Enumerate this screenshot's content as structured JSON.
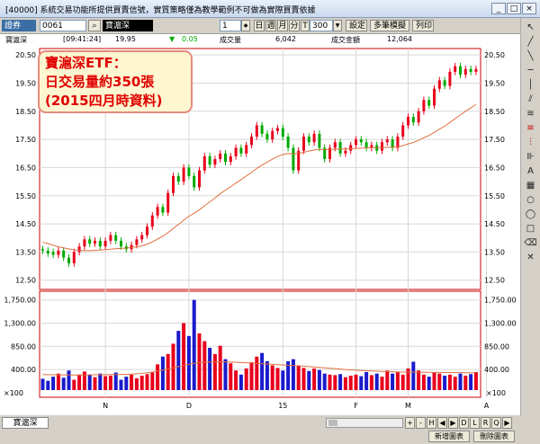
{
  "window": {
    "title": "[40000] 系統交易功能所提供買賣信號，實質策略僅為教學範例不可做為實際買賣依據",
    "minimize_glyph": "_",
    "restore_glyph": "□",
    "close_glyph": "×"
  },
  "toolbar": {
    "market_select": "證券",
    "symbol_code": "0061",
    "symbol_name": "寶滬深",
    "field_value": "1",
    "period_buttons": [
      "日",
      "週",
      "月",
      "分",
      "T"
    ],
    "count_value": "300",
    "settings_label": "設定",
    "params_label": "多筆模擬",
    "print_label": "列印"
  },
  "infobar": {
    "name": "寶滬深",
    "time": "[09:41:24]",
    "price": "19.95",
    "change_arrow": "▼",
    "change": "0.05",
    "volume_label": "成交量",
    "volume_value": "6,042",
    "amount_label": "成交金額",
    "amount_value": "12,064"
  },
  "annotation": {
    "line1": "寶滬深ETF：",
    "line2": "日交易量約350張",
    "line3": "(2015四月時資料)"
  },
  "bottom": {
    "tab_label": "寶滬深",
    "add_chart_label": "新增圖表",
    "remove_chart_label": "刪除圖表",
    "nav_buttons": [
      "+",
      "-",
      "H",
      "◀",
      "▶",
      "D",
      "L",
      "R",
      "Q",
      "▶"
    ]
  },
  "sidebar": {
    "tools": [
      "cursor-tool",
      "line-tool",
      "diagonal-tool",
      "horizontal-tool",
      "vertical-tool",
      "parallel-tool",
      "fan-tool",
      "fibonacci-tool",
      "text-tool",
      "grid-tool",
      "circle-tool",
      "ellipse-tool",
      "rectangle-tool",
      "eraser-tool",
      "delete-tool"
    ]
  },
  "colors": {
    "up": "#e8001c",
    "down": "#00aa00",
    "volume_down": "#1a1acc",
    "ma": "#e07040",
    "grid": "#d8d8d8",
    "panel_border": "#cc0000"
  },
  "chart_data": {
    "type": "candlestick",
    "price_axis": {
      "ticks": [
        "20.50",
        "19.50",
        "18.50",
        "17.50",
        "16.50",
        "15.50",
        "14.50",
        "13.50",
        "12.50"
      ],
      "ylim": [
        12.3,
        20.6
      ]
    },
    "volume_axis": {
      "ticks": [
        "1,750.00",
        "1,300.00",
        "850.00",
        "400.00"
      ],
      "ylim": [
        0,
        1850
      ]
    },
    "volume_unit_label": "×100",
    "x_ticks": [
      {
        "label": "N",
        "i": 12
      },
      {
        "label": "D",
        "i": 28
      },
      {
        "label": "15",
        "i": 46
      },
      {
        "label": "F",
        "i": 60
      },
      {
        "label": "M",
        "i": 70
      },
      {
        "label": "A",
        "i": 85
      }
    ],
    "candles": [
      [
        13.6,
        13.55
      ],
      [
        13.55,
        13.45
      ],
      [
        13.5,
        13.4
      ],
      [
        13.4,
        13.55
      ],
      [
        13.55,
        13.3
      ],
      [
        13.3,
        13.1
      ],
      [
        13.1,
        13.5
      ],
      [
        13.5,
        13.7
      ],
      [
        13.7,
        13.95
      ],
      [
        13.95,
        13.8
      ],
      [
        13.8,
        13.9
      ],
      [
        13.9,
        13.7
      ],
      [
        13.7,
        13.9
      ],
      [
        13.9,
        14.1
      ],
      [
        14.1,
        13.9
      ],
      [
        13.9,
        13.7
      ],
      [
        13.7,
        13.6
      ],
      [
        13.6,
        13.75
      ],
      [
        13.75,
        13.95
      ],
      [
        13.95,
        14.1
      ],
      [
        14.1,
        14.4
      ],
      [
        14.4,
        14.8
      ],
      [
        14.8,
        15.1
      ],
      [
        15.1,
        14.9
      ],
      [
        14.9,
        15.6
      ],
      [
        15.6,
        16.2
      ],
      [
        16.2,
        16.0
      ],
      [
        16.0,
        16.5
      ],
      [
        16.5,
        16.2
      ],
      [
        16.2,
        15.8
      ],
      [
        15.8,
        16.4
      ],
      [
        16.4,
        16.9
      ],
      [
        16.9,
        16.6
      ],
      [
        16.6,
        16.8
      ],
      [
        16.8,
        17.0
      ],
      [
        17.0,
        16.7
      ],
      [
        16.7,
        16.9
      ],
      [
        16.9,
        17.2
      ],
      [
        17.2,
        17.0
      ],
      [
        17.0,
        17.3
      ],
      [
        17.3,
        17.6
      ],
      [
        17.6,
        18.0
      ],
      [
        18.0,
        17.7
      ],
      [
        17.7,
        17.5
      ],
      [
        17.5,
        17.8
      ],
      [
        17.8,
        17.9
      ],
      [
        17.9,
        17.6
      ],
      [
        17.6,
        17.2
      ],
      [
        17.2,
        16.4
      ],
      [
        16.4,
        17.1
      ],
      [
        17.1,
        17.6
      ],
      [
        17.6,
        17.4
      ],
      [
        17.4,
        17.7
      ],
      [
        17.7,
        17.2
      ],
      [
        17.2,
        16.8
      ],
      [
        16.8,
        17.2
      ],
      [
        17.2,
        17.4
      ],
      [
        17.4,
        17.0
      ],
      [
        17.0,
        17.1
      ],
      [
        17.1,
        17.3
      ],
      [
        17.3,
        17.5
      ],
      [
        17.5,
        17.4
      ],
      [
        17.4,
        17.2
      ],
      [
        17.2,
        17.3
      ],
      [
        17.3,
        17.1
      ],
      [
        17.1,
        17.4
      ],
      [
        17.4,
        17.5
      ],
      [
        17.5,
        17.2
      ],
      [
        17.2,
        17.6
      ],
      [
        17.6,
        18.0
      ],
      [
        18.0,
        18.3
      ],
      [
        18.3,
        18.1
      ],
      [
        18.1,
        18.5
      ],
      [
        18.5,
        18.9
      ],
      [
        18.9,
        18.7
      ],
      [
        18.7,
        19.3
      ],
      [
        19.3,
        19.6
      ],
      [
        19.6,
        19.4
      ],
      [
        19.4,
        19.9
      ],
      [
        19.9,
        20.1
      ],
      [
        20.1,
        19.8
      ],
      [
        19.8,
        20.0
      ],
      [
        20.0,
        19.9
      ],
      [
        19.9,
        20.0
      ]
    ],
    "ma": [
      13.85,
      13.8,
      13.74,
      13.69,
      13.65,
      13.61,
      13.58,
      13.56,
      13.55,
      13.55,
      13.56,
      13.57,
      13.58,
      13.6,
      13.62,
      13.63,
      13.64,
      13.66,
      13.68,
      13.72,
      13.78,
      13.86,
      13.96,
      14.06,
      14.19,
      14.34,
      14.48,
      14.63,
      14.77,
      14.88,
      15.0,
      15.14,
      15.28,
      15.42,
      15.57,
      15.7,
      15.82,
      15.95,
      16.07,
      16.2,
      16.33,
      16.47,
      16.59,
      16.69,
      16.8,
      16.9,
      16.96,
      17.0,
      16.99,
      17.0,
      17.04,
      17.09,
      17.12,
      17.15,
      17.14,
      17.14,
      17.15,
      17.16,
      17.16,
      17.17,
      17.18,
      17.19,
      17.2,
      17.21,
      17.21,
      17.21,
      17.22,
      17.22,
      17.24,
      17.28,
      17.34,
      17.39,
      17.47,
      17.56,
      17.64,
      17.75,
      17.87,
      17.97,
      18.1,
      18.24,
      18.37,
      18.5,
      18.62,
      18.74
    ],
    "volume": [
      220,
      180,
      260,
      320,
      240,
      380,
      200,
      300,
      360,
      290,
      250,
      320,
      270,
      280,
      340,
      200,
      260,
      300,
      230,
      280,
      310,
      340,
      500,
      650,
      700,
      900,
      1150,
      1300,
      1050,
      1750,
      1100,
      950,
      820,
      700,
      860,
      600,
      520,
      380,
      300,
      420,
      540,
      650,
      720,
      560,
      480,
      430,
      380,
      560,
      600,
      480,
      430,
      370,
      420,
      390,
      320,
      300,
      290,
      310,
      250,
      280,
      300,
      270,
      350,
      290,
      320,
      260,
      380,
      320,
      350,
      300,
      420,
      550,
      380,
      300,
      260,
      340,
      320,
      280,
      300,
      260,
      320,
      280,
      310,
      350
    ],
    "volume_ma": [
      300,
      298,
      296,
      295,
      294,
      294,
      293,
      293,
      295,
      296,
      296,
      297,
      298,
      300,
      302,
      304,
      306,
      310,
      316,
      324,
      336,
      350,
      368,
      388,
      410,
      432,
      456,
      480,
      500,
      520,
      532,
      540,
      546,
      548,
      550,
      548,
      544,
      540,
      534,
      530,
      524,
      518,
      512,
      506,
      500,
      494,
      488,
      482,
      476,
      470,
      464,
      456,
      448,
      440,
      432,
      424,
      416,
      408,
      400,
      392,
      386,
      380,
      375,
      370,
      366,
      362,
      358,
      355,
      352,
      350,
      348,
      347,
      346,
      345,
      344,
      343,
      342,
      341,
      340,
      339,
      338,
      337,
      336,
      335
    ]
  }
}
